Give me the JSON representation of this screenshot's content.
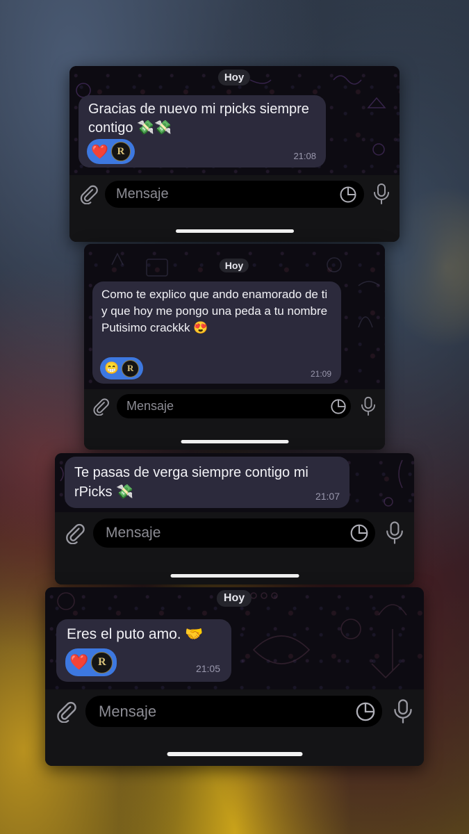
{
  "panels": [
    {
      "date": "Hoy",
      "message": "Gracias de nuevo mi rpicks siempre contigo 💸💸",
      "time": "21:08",
      "reactions": {
        "emoji": "❤️",
        "avatar": "R"
      },
      "input_placeholder": "Mensaje"
    },
    {
      "date": "Hoy",
      "message": "Como te explico que ando enamorado de ti y que hoy me pongo una peda a tu nombre\nPutisimo crackkk 😍",
      "time": "21:09",
      "reactions": {
        "emoji": "😁",
        "avatar": "R"
      },
      "input_placeholder": "Mensaje"
    },
    {
      "message": "Te pasas de verga siempre contigo mi rPicks 💸",
      "time": "21:07",
      "input_placeholder": "Mensaje"
    },
    {
      "date": "Hoy",
      "message": "Eres el puto amo. 🤝",
      "time": "21:05",
      "reactions": {
        "emoji": "❤️",
        "avatar": "R"
      },
      "input_placeholder": "Mensaje"
    }
  ],
  "colors": {
    "bubble": "#2c2a3c",
    "reaction_pill": "#3d78e0",
    "input_bar": "#141416"
  },
  "icons": [
    "paperclip-icon",
    "sticker-icon",
    "microphone-icon"
  ]
}
